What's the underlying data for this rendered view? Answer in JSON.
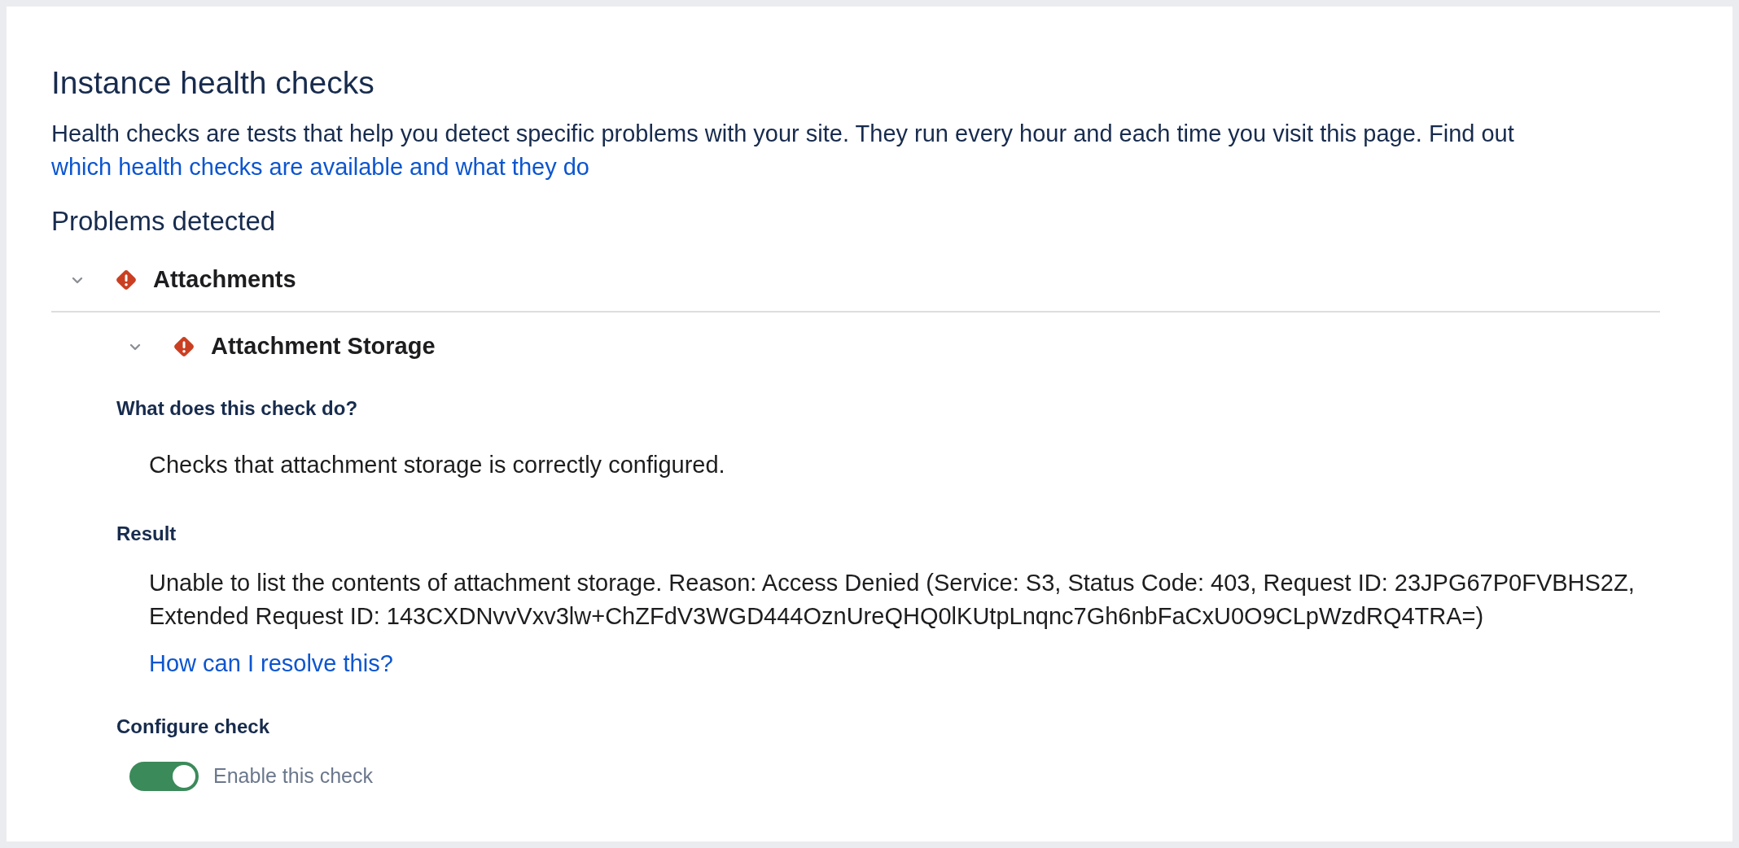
{
  "title": "Instance health checks",
  "intro": {
    "text": "Health checks are tests that help you detect specific problems with your site. They run every hour and each time you visit this page. Find out",
    "link": "which health checks are available and what they do"
  },
  "section_heading": "Problems detected",
  "groups": [
    {
      "name": "Attachments",
      "kind": "error",
      "expanded": true,
      "checks": [
        {
          "name": "Attachment Storage",
          "kind": "error",
          "expanded": true,
          "what_heading": "What does this check do?",
          "what_text": "Checks that attachment storage is correctly configured.",
          "result_heading": "Result",
          "result_text": "Unable to list the contents of attachment storage. Reason: Access Denied (Service: S3, Status Code: 403, Request ID: 23JPG67P0FVBHS2Z, Extended Request ID: 143CXDNvvVxv3lw+ChZFdV3WGD444OznUreQHQ0lKUtpLnqnc7Gh6nbFaCxU0O9CLpWzdRQ4TRA=)",
          "resolve_link": "How can I resolve this?",
          "configure_heading": "Configure check",
          "toggle": {
            "label": "Enable this check",
            "on": true
          }
        }
      ]
    }
  ]
}
